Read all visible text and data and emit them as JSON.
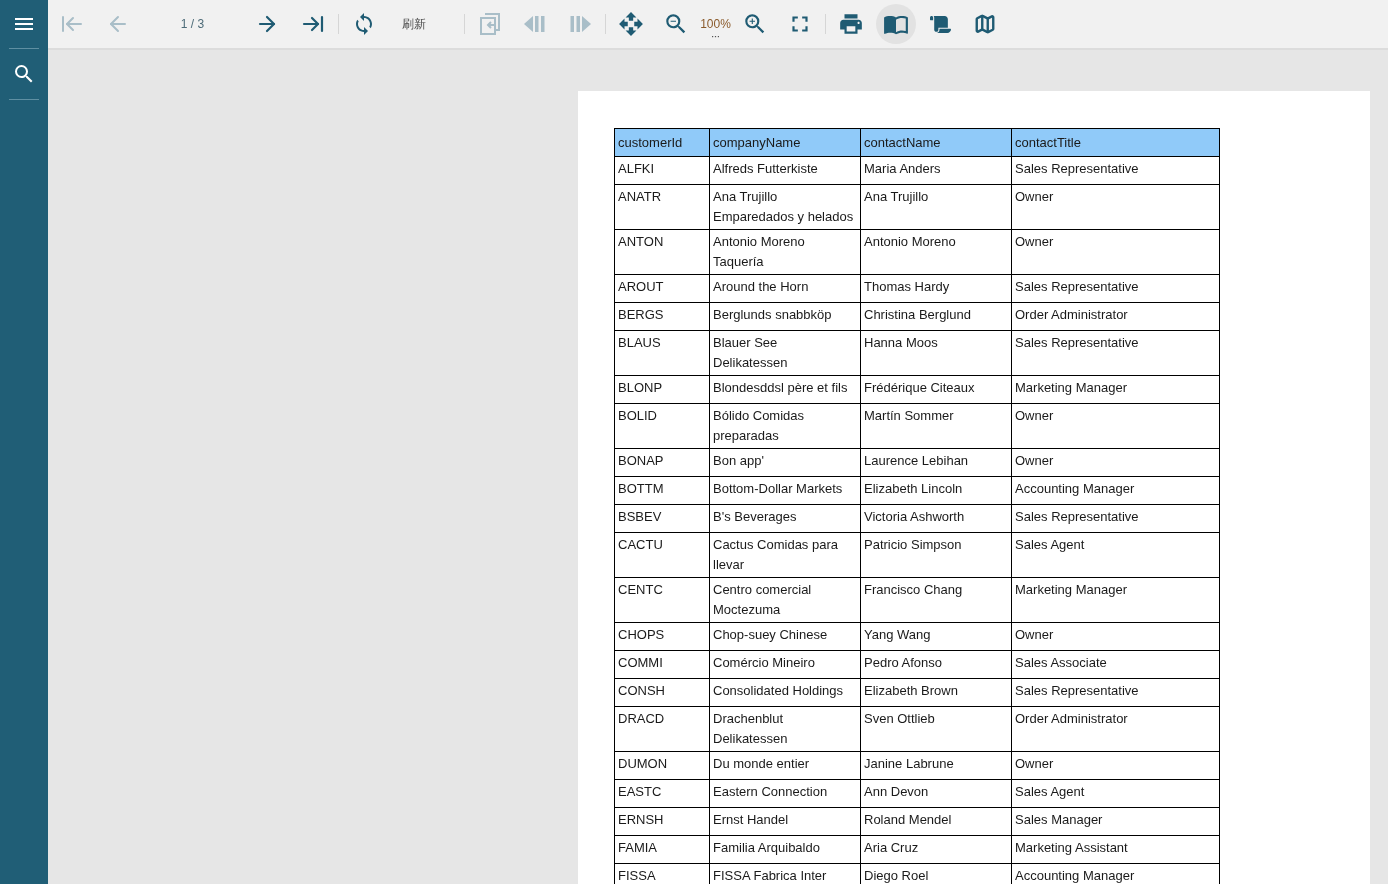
{
  "toolbar": {
    "groups": [
      [
        {
          "kind": "first",
          "disabled": true
        },
        {
          "kind": "previous",
          "disabled": true
        },
        {
          "kind": "page",
          "label": "1 / 3"
        },
        {
          "kind": "next",
          "disabled": false
        },
        {
          "kind": "last",
          "disabled": false
        }
      ],
      [
        {
          "kind": "refresh",
          "disabled": false
        },
        {
          "kind": "text_button",
          "label": "刷新"
        }
      ],
      [
        {
          "kind": "export",
          "disabled": true
        },
        {
          "kind": "previous_section",
          "disabled": true
        },
        {
          "kind": "next_section",
          "disabled": true
        }
      ],
      [
        {
          "kind": "move",
          "disabled": false
        },
        {
          "kind": "zoom_out",
          "disabled": false
        },
        {
          "kind": "zoom",
          "label": "100%"
        },
        {
          "kind": "zoom_in",
          "disabled": false
        },
        {
          "kind": "fullscreen",
          "disabled": false
        }
      ],
      [
        {
          "kind": "print",
          "disabled": false
        },
        {
          "kind": "book_view",
          "selected": true
        },
        {
          "kind": "scroll_view",
          "selected": false
        },
        {
          "kind": "map_view",
          "selected": false
        }
      ]
    ]
  },
  "table": {
    "columns": [
      "customerId",
      "companyName",
      "contactName",
      "contactTitle"
    ],
    "rows": [
      [
        "ALFKI",
        "Alfreds Futterkiste",
        "Maria Anders",
        "Sales Representative"
      ],
      [
        "ANATR",
        "Ana Trujillo Emparedados y helados",
        "Ana Trujillo",
        "Owner"
      ],
      [
        "ANTON",
        "Antonio Moreno Taquería",
        "Antonio Moreno",
        "Owner"
      ],
      [
        "AROUT",
        "Around the Horn",
        "Thomas Hardy",
        "Sales Representative"
      ],
      [
        "BERGS",
        "Berglunds snabbköp",
        "Christina Berglund",
        "Order Administrator"
      ],
      [
        "BLAUS",
        "Blauer See Delikatessen",
        "Hanna Moos",
        "Sales Representative"
      ],
      [
        "BLONP",
        "Blondesddsl père et fils",
        "Frédérique Citeaux",
        "Marketing Manager"
      ],
      [
        "BOLID",
        "Bólido Comidas preparadas",
        "Martín Sommer",
        "Owner"
      ],
      [
        "BONAP",
        "Bon app'",
        "Laurence Lebihan",
        "Owner"
      ],
      [
        "BOTTM",
        "Bottom-Dollar Markets",
        "Elizabeth Lincoln",
        "Accounting Manager"
      ],
      [
        "BSBEV",
        "B's Beverages",
        "Victoria Ashworth",
        "Sales Representative"
      ],
      [
        "CACTU",
        "Cactus Comidas para llevar",
        "Patricio Simpson",
        "Sales Agent"
      ],
      [
        "CENTC",
        "Centro comercial Moctezuma",
        "Francisco Chang",
        "Marketing Manager"
      ],
      [
        "CHOPS",
        "Chop-suey Chinese",
        "Yang Wang",
        "Owner"
      ],
      [
        "COMMI",
        "Comércio Mineiro",
        "Pedro Afonso",
        "Sales Associate"
      ],
      [
        "CONSH",
        "Consolidated Holdings",
        "Elizabeth Brown",
        "Sales Representative"
      ],
      [
        "DRACD",
        "Drachenblut Delikatessen",
        "Sven Ottlieb",
        "Order Administrator"
      ],
      [
        "DUMON",
        "Du monde entier",
        "Janine Labrune",
        "Owner"
      ],
      [
        "EASTC",
        "Eastern Connection",
        "Ann Devon",
        "Sales Agent"
      ],
      [
        "ERNSH",
        "Ernst Handel",
        "Roland Mendel",
        "Sales Manager"
      ],
      [
        "FAMIA",
        "Familia Arquibaldo",
        "Aria Cruz",
        "Marketing Assistant"
      ],
      [
        "FISSA",
        "FISSA Fabrica Inter",
        "Diego Roel",
        "Accounting Manager"
      ]
    ]
  }
}
